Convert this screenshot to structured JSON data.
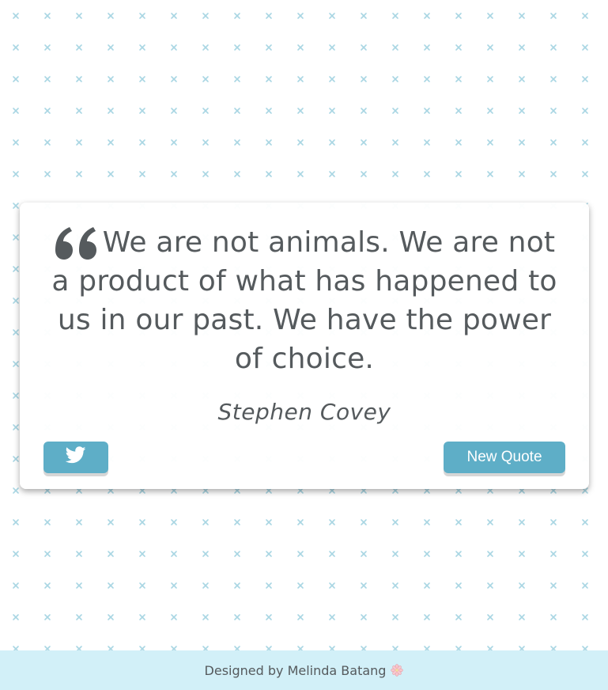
{
  "quote": {
    "icon": "quote-left-icon",
    "text": "We are not animals. We are not a product of what has happened to us in our past. We have the power of choice.",
    "author": "Stephen Covey"
  },
  "actions": {
    "tweet_icon": "twitter-icon",
    "new_quote_label": "New Quote"
  },
  "footer": {
    "credit": "Designed by Melinda Batang",
    "icon": "flower-icon"
  },
  "colors": {
    "text": "#555a5d",
    "button": "#5eaec7",
    "footer_bg": "#d2f0f8",
    "pattern": "#a9d6e3"
  }
}
